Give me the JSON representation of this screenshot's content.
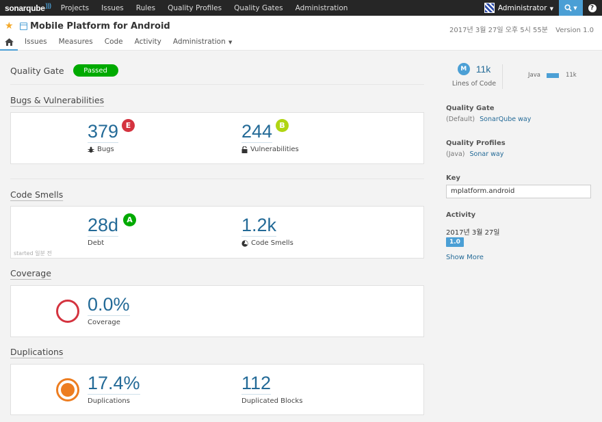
{
  "topnav": {
    "logo": "sonarqube",
    "links": [
      "Projects",
      "Issues",
      "Rules",
      "Quality Profiles",
      "Quality Gates",
      "Administration"
    ],
    "user": "Administrator",
    "search_icon": "search-icon",
    "help_label": "?"
  },
  "project": {
    "name": "Mobile Platform for Android",
    "date": "2017년 3월 27일 오후 5시 55분",
    "version": "Version 1.0",
    "tabs": [
      "Issues",
      "Measures",
      "Code",
      "Activity",
      "Administration"
    ]
  },
  "quality_gate": {
    "label": "Quality Gate",
    "status": "Passed"
  },
  "bugs_vulns": {
    "title": "Bugs & Vulnerabilities",
    "bugs": {
      "value": "379",
      "label": "Bugs",
      "rating": "E",
      "rating_color": "#d4333f"
    },
    "vulnerabilities": {
      "value": "244",
      "label": "Vulnerabilities",
      "rating": "B",
      "rating_color": "#b0d513"
    }
  },
  "code_smells": {
    "title": "Code Smells",
    "debt": {
      "value": "28d",
      "label": "Debt",
      "rating": "A",
      "rating_color": "#00aa00"
    },
    "smells": {
      "value": "1.2k",
      "label": "Code Smells"
    },
    "started": "started 일분 전"
  },
  "coverage": {
    "title": "Coverage",
    "value": "0.0%",
    "label": "Coverage",
    "color": "#d4333f"
  },
  "duplications": {
    "title": "Duplications",
    "value": "17.4%",
    "label": "Duplications",
    "blocks_value": "112",
    "blocks_label": "Duplicated Blocks",
    "color": "#ed7d20"
  },
  "sidebar": {
    "loc_badge": "M",
    "loc_value": "11k",
    "loc_label": "Lines of Code",
    "lang_name": "Java",
    "lang_value": "11k",
    "qg_title": "Quality Gate",
    "qg_prefix": "(Default)",
    "qg_link": "SonarQube way",
    "qp_title": "Quality Profiles",
    "qp_prefix": "(Java)",
    "qp_link": "Sonar way",
    "key_title": "Key",
    "key_value": "mplatform.android",
    "activity_title": "Activity",
    "activity_date": "2017년 3월 27일",
    "activity_version": "1.0",
    "show_more": "Show More"
  },
  "colors": {
    "accent": "#4b9fd5",
    "value_blue": "#236a97",
    "topbar": "#262626"
  }
}
